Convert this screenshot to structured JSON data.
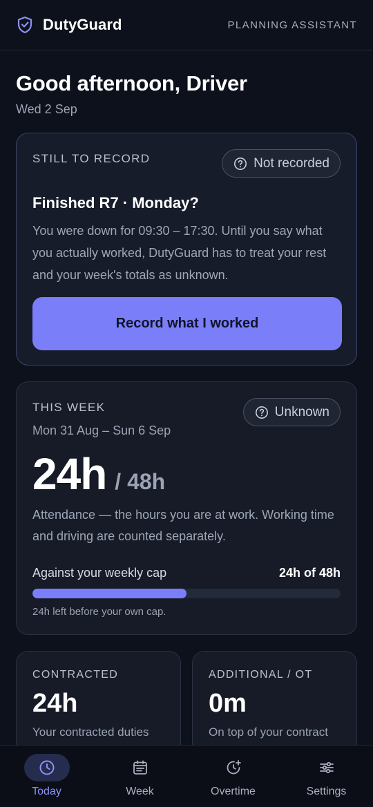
{
  "header": {
    "brand": "DutyGuard",
    "tag": "PLANNING ASSISTANT",
    "icon": "shield-check-icon"
  },
  "greeting": {
    "title": "Good afternoon, Driver",
    "date": "Wed 2 Sep"
  },
  "record_card": {
    "label": "STILL TO RECORD",
    "status": "Not recorded",
    "title": "Finished R7 · Monday?",
    "body": "You were down for 09:30 – 17:30. Until you say what you actually worked, DutyGuard has to treat your rest and your week's totals as unknown.",
    "button": "Record what I worked"
  },
  "week_card": {
    "label": "THIS WEEK",
    "status": "Unknown",
    "range": "Mon 31 Aug – Sun 6 Sep",
    "hours": "24h",
    "cap": "/ 48h",
    "note": "Attendance — the hours you are at work. Working time and driving are counted separately.",
    "cap_label": "Against your weekly cap",
    "cap_value": "24h of 48h",
    "progress_fraction": 0.5,
    "cap_left": "24h left before your own cap."
  },
  "contracted": {
    "label": "CONTRACTED",
    "value": "24h",
    "sub": "Your contracted duties"
  },
  "additional": {
    "label": "ADDITIONAL / OT",
    "value": "0m",
    "sub": "On top of your contract"
  },
  "nav": {
    "items": [
      {
        "label": "Today",
        "icon": "clock-icon",
        "active": true
      },
      {
        "label": "Week",
        "icon": "calendar-icon",
        "active": false
      },
      {
        "label": "Overtime",
        "icon": "clock-plus-icon",
        "active": false
      },
      {
        "label": "Settings",
        "icon": "sliders-icon",
        "active": false
      }
    ]
  },
  "colors": {
    "accent": "#7a7ef8",
    "background": "#0d111b",
    "card": "#161b27"
  }
}
